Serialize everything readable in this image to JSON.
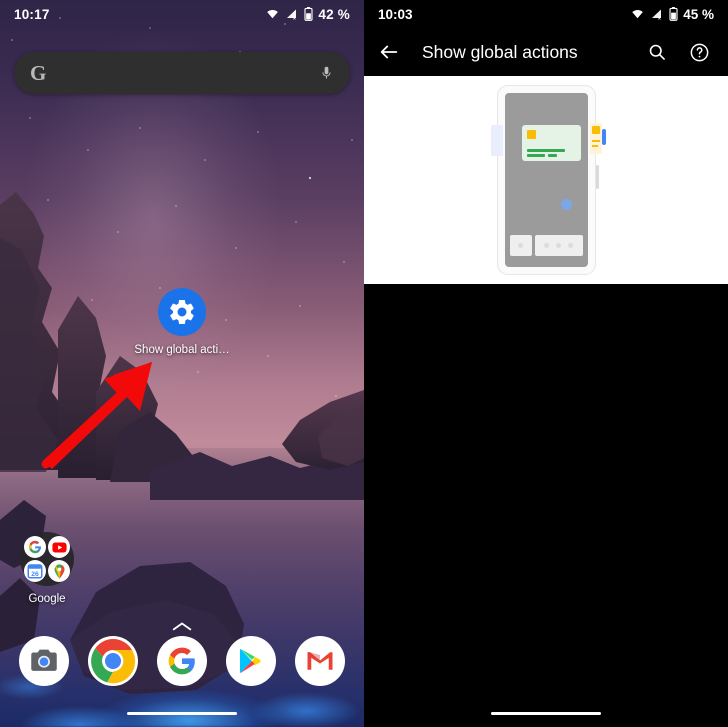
{
  "left_phone": {
    "status_bar": {
      "time": "10:17",
      "battery_percent": "42 %",
      "icons": [
        "wifi-icon",
        "cellular-no-sim-icon",
        "battery-icon"
      ]
    },
    "search_widget": {
      "google_letter": "G",
      "mic_icon": "microphone-icon",
      "placeholder": ""
    },
    "app_shortcut": {
      "label": "Show global acti…",
      "icon": "gear-icon",
      "icon_color": "#1a73e8"
    },
    "annotation": {
      "type": "red-arrow",
      "color": "#f20a0a",
      "points_to": "Show global acti… app shortcut"
    },
    "folder": {
      "label": "Google",
      "apps": [
        "google-icon",
        "youtube-icon",
        "calendar-icon",
        "maps-icon"
      ],
      "calendar_day": "26"
    },
    "page_indicator": "chevron-up-icon",
    "dock": {
      "apps": [
        "camera-icon",
        "chrome-icon",
        "google-icon",
        "play-store-icon",
        "gmail-icon"
      ]
    },
    "nav_gesture_bar": "home-gesture-pill"
  },
  "right_phone": {
    "status_bar": {
      "time": "10:03",
      "battery_percent": "45 %",
      "icons": [
        "wifi-icon",
        "cellular-no-sim-icon",
        "battery-icon"
      ]
    },
    "app_bar": {
      "back_icon": "arrow-back-icon",
      "title": "Show global actions",
      "search_icon": "search-icon",
      "help_icon": "help-circle-icon"
    },
    "illustration": {
      "name": "accessibility-phone-illustration",
      "background": "#ffffff",
      "device_body_color": "#9b9b9b",
      "card_color": "#e4f3e6",
      "accent_yellow": "#fbbc05",
      "accent_green": "#34a853",
      "accent_blue": "#4285f4"
    },
    "content_background": "#000000",
    "nav_gesture_bar": "home-gesture-pill"
  }
}
